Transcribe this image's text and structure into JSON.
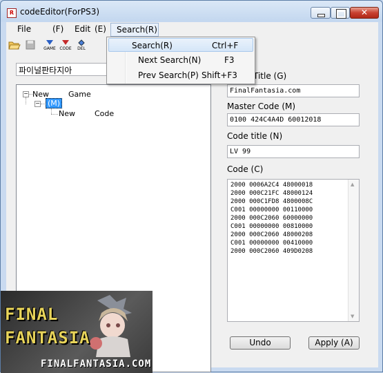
{
  "window": {
    "title": "codeEditor(ForPS3)"
  },
  "menu": {
    "file": "File",
    "file_mn": "(F)",
    "edit": "Edit",
    "edit_mn": "(E)",
    "search": "Search(R)"
  },
  "toolbar": {
    "game_label": "GAME",
    "code_label": "CODE",
    "del_label": "DEL"
  },
  "search_box": {
    "value": "파이널판타지아"
  },
  "tree": {
    "root": "New        Game",
    "child": "(M)",
    "leaf": "New        Code"
  },
  "form": {
    "game_title_label": "Title (G)",
    "game_title_value": "FinalFantasia.com",
    "master_code_label": "Master Code (M)",
    "master_code_value": "0100 424C4A4D 60012018",
    "code_title_label": "Code title  (N)",
    "code_title_value": "LV 99",
    "code_label": "Code    (C)",
    "code_lines": "2000 0006A2C4 48000018\n2000 000C21FC 48000124\n2000 000C1FD8 4800008C\nC001 00000000 00110000\n2000 000C2060 60000000\nC001 00000000 00810000\n2000 000C2060 48000208\nC001 00000000 00410000\n2000 000C2060 409D0208"
  },
  "buttons": {
    "undo": "Undo",
    "apply": "Apply (A)"
  },
  "search_menu": {
    "items": [
      {
        "label": "Search(R)",
        "shortcut": "Ctrl+F"
      },
      {
        "label": "Next Search(N)",
        "shortcut": "F3"
      },
      {
        "label": "Prev Search(P)",
        "shortcut": "Shift+F3"
      }
    ]
  },
  "watermark": {
    "line1": "FINAL",
    "line2": "FANTASIA",
    "url": "FINALFANTASIA.COM"
  },
  "colors": {
    "accent": "#3399ff",
    "logo_text": "#e8d45a",
    "close_button": "#c84030"
  }
}
